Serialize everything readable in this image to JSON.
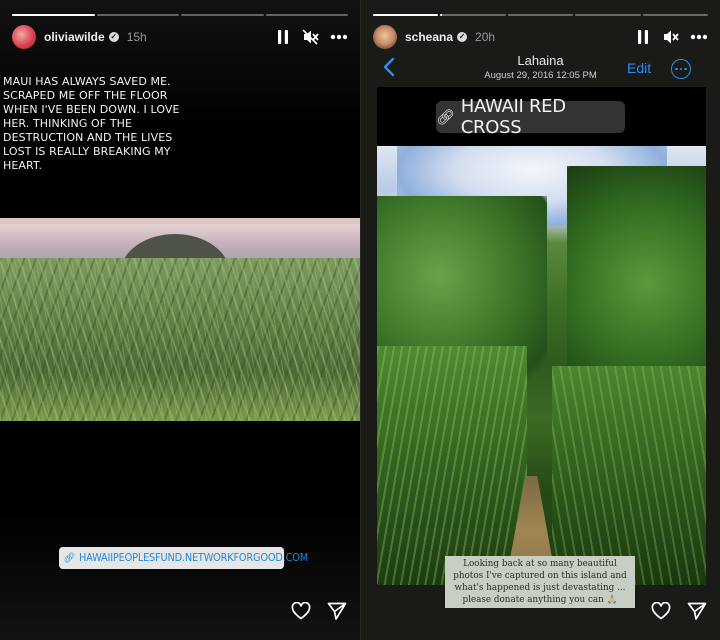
{
  "left_story": {
    "username": "oliviawilde",
    "time_ago": "15h",
    "progress": [
      1.0,
      0.0,
      0.0,
      0.0
    ],
    "quote": "MAUI HAS ALWAYS SAVED ME. SCRAPED ME OFF THE FLOOR WHEN I'VE BEEN DOWN. I LOVE HER. THINKING OF THE DESTRUCTION AND THE LIVES LOST IS REALLY BREAKING MY HEART.",
    "link_sticker": "HAWAIIPEOPLESFUND.NETWORKFORGOOD.COM",
    "icons": {
      "pause": "pause-icon",
      "mute": "muted-speaker-icon",
      "more": "more-dots-icon",
      "like": "heart-icon",
      "share": "paper-plane-icon",
      "link": "link-icon"
    }
  },
  "right_story": {
    "username": "scheana",
    "time_ago": "20h",
    "progress": [
      1.0,
      0.02,
      0.0,
      0.0,
      0.0
    ],
    "photo_header": {
      "title": "Lahaina",
      "date": "August 29, 2016  12:05 PM",
      "edit_label": "Edit"
    },
    "link_sticker": "HAWAII RED CROSS",
    "caption": "Looking back at so many beautiful photos I've captured on this island and what's happened is just devastating ... please donate anything you can 🙏🏼",
    "icons": {
      "pause": "pause-icon",
      "mute": "muted-speaker-icon",
      "more": "more-dots-icon",
      "like": "heart-icon",
      "share": "paper-plane-icon",
      "link": "link-icon",
      "back": "chevron-left-icon"
    }
  },
  "colors": {
    "ios_accent": "#2d8cf0",
    "link_sticker_text": "#1f8ad8"
  }
}
